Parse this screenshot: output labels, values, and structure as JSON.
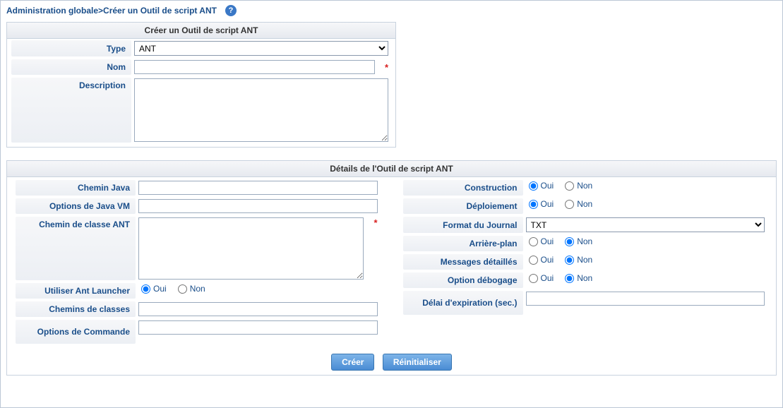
{
  "breadcrumb": {
    "root": "Administration globale",
    "current": "Créer un Outil de script ANT"
  },
  "help_icon": "?",
  "panel1": {
    "title": "Créer un Outil de script ANT",
    "fields": {
      "type_label": "Type",
      "type_value": "ANT",
      "name_label": "Nom",
      "name_value": "",
      "desc_label": "Description",
      "desc_value": ""
    }
  },
  "panel2": {
    "title": "Détails de l'Outil de script ANT",
    "left": {
      "java_path_label": "Chemin Java",
      "java_path_value": "",
      "jvm_opts_label": "Options de Java VM",
      "jvm_opts_value": "",
      "ant_classpath_label": "Chemin de classe ANT",
      "ant_classpath_value": "",
      "use_launcher_label": "Utiliser Ant Launcher",
      "use_launcher_value": "Oui",
      "classpaths_label": "Chemins de classes",
      "classpaths_value": "",
      "cmd_opts_label": "Options de Commande",
      "cmd_opts_value": ""
    },
    "right": {
      "build_label": "Construction",
      "build_value": "Oui",
      "deploy_label": "Déploiement",
      "deploy_value": "Oui",
      "log_format_label": "Format du Journal",
      "log_format_value": "TXT",
      "background_label": "Arrière-plan",
      "background_value": "Non",
      "verbose_label": "Messages détaillés",
      "verbose_value": "Non",
      "debug_label": "Option débogage",
      "debug_value": "Non",
      "timeout_label": "Délai d'expiration (sec.)",
      "timeout_value": ""
    }
  },
  "radio": {
    "yes": "Oui",
    "no": "Non"
  },
  "buttons": {
    "create": "Créer",
    "reset": "Réinitialiser"
  },
  "required_marker": "*"
}
